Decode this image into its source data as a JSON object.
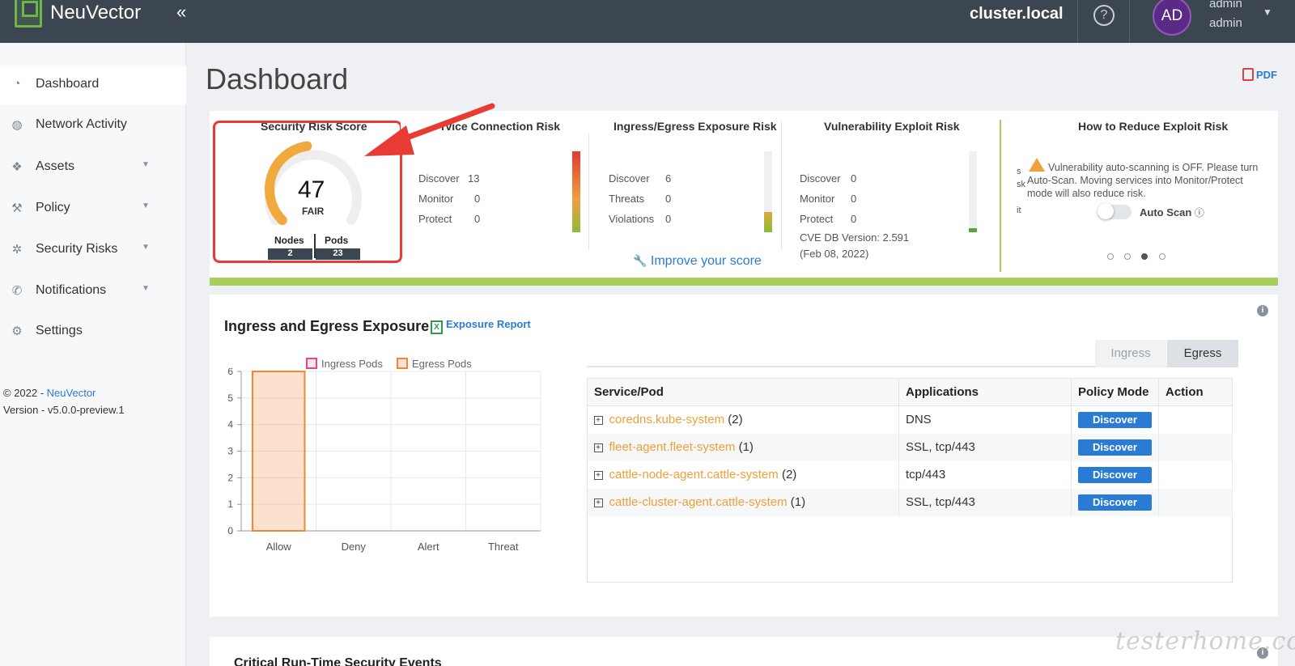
{
  "topbar": {
    "brand": "NeuVector",
    "collapse_icon": "«",
    "cluster": "cluster.local",
    "help_icon": "?",
    "avatar_initials": "AD",
    "user_name": "admin",
    "user_role": "admin"
  },
  "sidebar": {
    "items": [
      {
        "label": "Dashboard",
        "icon": "dashboard-icon",
        "active": true
      },
      {
        "label": "Network Activity",
        "icon": "globe-icon"
      },
      {
        "label": "Assets",
        "icon": "cubes-icon",
        "dropdown": true
      },
      {
        "label": "Policy",
        "icon": "gavel-icon",
        "dropdown": true
      },
      {
        "label": "Security Risks",
        "icon": "bug-icon",
        "dropdown": true
      },
      {
        "label": "Notifications",
        "icon": "phone-icon",
        "dropdown": true
      },
      {
        "label": "Settings",
        "icon": "wrench-icon"
      }
    ],
    "copyright_prefix": "© 2022 - ",
    "copyright_link": "NeuVector",
    "version": "Version - v5.0.0-preview.1"
  },
  "page": {
    "title": "Dashboard",
    "pdf_label": "PDF"
  },
  "risk": {
    "score_title": "Security Risk Score",
    "score": "47",
    "score_level": "FAIR",
    "score_fraction": 0.47,
    "nodes_label": "Nodes",
    "nodes": "2",
    "pods_label": "Pods",
    "pods": "23",
    "service_title": "rvice Connection Risk",
    "service": [
      {
        "k": "Discover",
        "v": "13"
      },
      {
        "k": "Monitor",
        "v": "0"
      },
      {
        "k": "Protect",
        "v": "0"
      }
    ],
    "ingress_title": "Ingress/Egress Exposure Risk",
    "ingress": [
      {
        "k": "Discover",
        "v": "6"
      },
      {
        "k": "Threats",
        "v": "0"
      },
      {
        "k": "Violations",
        "v": "0"
      }
    ],
    "improve_label": "Improve your score",
    "vuln_title": "Vulnerability Exploit Risk",
    "vuln": [
      {
        "k": "Discover",
        "v": "0"
      },
      {
        "k": "Monitor",
        "v": "0"
      },
      {
        "k": "Protect",
        "v": "0"
      }
    ],
    "cve_line1": "CVE DB Version: 2.591",
    "cve_line2": "(Feb 08, 2022)",
    "reduce_title": "How to Reduce Exploit Risk",
    "reduce_text": "Vulnerability auto-scanning is OFF. Please turn Auto-Scan. Moving services into Monitor/Protect mode will also reduce risk.",
    "reduce_cut_s": "s",
    "reduce_cut_sk": "sk",
    "reduce_cut_it": "it",
    "auto_scan_label": "Auto Scan",
    "auto_scan_on": false,
    "carousel_active": 3
  },
  "exposure": {
    "title": "Ingress and Egress Exposure",
    "report_label": "Exposure Report",
    "tabs": [
      "Ingress",
      "Egress"
    ],
    "active_tab": "Egress",
    "table": {
      "headers": [
        "Service/Pod",
        "Applications",
        "Policy Mode",
        "Action"
      ],
      "rows": [
        {
          "name": "coredns.kube-system",
          "count": "(2)",
          "apps": "DNS",
          "mode": "Discover"
        },
        {
          "name": "fleet-agent.fleet-system",
          "count": "(1)",
          "apps": "SSL, tcp/443",
          "mode": "Discover"
        },
        {
          "name": "cattle-node-agent.cattle-system",
          "count": "(2)",
          "apps": "tcp/443",
          "mode": "Discover"
        },
        {
          "name": "cattle-cluster-agent.cattle-system",
          "count": "(1)",
          "apps": "SSL, tcp/443",
          "mode": "Discover"
        }
      ]
    }
  },
  "chart_data": {
    "type": "bar",
    "categories": [
      "Allow",
      "Deny",
      "Alert",
      "Threat"
    ],
    "series": [
      {
        "name": "Ingress Pods",
        "color": "#e5438a",
        "values": [
          0,
          0,
          0,
          0
        ]
      },
      {
        "name": "Egress Pods",
        "color": "#f0863a",
        "values": [
          6,
          0,
          0,
          0
        ]
      }
    ],
    "yticks": [
      "0",
      "1",
      "2",
      "3",
      "4",
      "5",
      "6"
    ],
    "ylim": [
      0,
      6
    ],
    "grid": true,
    "legend": "top"
  },
  "bottom": {
    "title": "Critical Run-Time Security Events"
  },
  "watermark": "testerhome.com",
  "colors": {
    "accent": "#2a7bd5",
    "risk_bar": "#a7cf5a",
    "highlight": "#e83b34",
    "link_orange": "#f0a035"
  }
}
